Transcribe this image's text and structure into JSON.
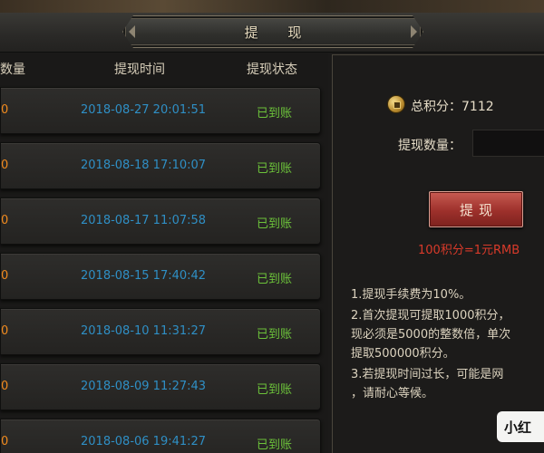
{
  "header": {
    "title": "提 现"
  },
  "table": {
    "columns": {
      "qty": "数量",
      "time": "提现时间",
      "status": "提现状态"
    },
    "rows": [
      {
        "qty": "0",
        "time": "2018-08-27 20:01:51",
        "status": "已到账"
      },
      {
        "qty": "0",
        "time": "2018-08-18 17:10:07",
        "status": "已到账"
      },
      {
        "qty": "0",
        "time": "2018-08-17 11:07:58",
        "status": "已到账"
      },
      {
        "qty": "0",
        "time": "2018-08-15 17:40:42",
        "status": "已到账"
      },
      {
        "qty": "0",
        "time": "2018-08-10 11:31:27",
        "status": "已到账"
      },
      {
        "qty": "0",
        "time": "2018-08-09 11:27:43",
        "status": "已到账"
      },
      {
        "qty": "0",
        "time": "2018-08-06 19:41:27",
        "status": "已到账"
      }
    ]
  },
  "panel": {
    "points_label": "总积分：7112",
    "qty_label": "提现数量：",
    "qty_value": "",
    "withdraw_button": "提现",
    "rate": "100积分=1元RMB",
    "rules": [
      "1.提现手续费为10%。",
      "2.首次提现可提取1000积分，",
      "现必须是5000的整数倍，单次",
      "提取500000积分。",
      "3.若提现时间过长，可能是网",
      "，请耐心等候。"
    ]
  },
  "watermark": {
    "text": "小红"
  },
  "colors": {
    "qty": "#f08a1e",
    "time": "#2f8fc5",
    "status": "#6cc23a",
    "rate": "#d93a2a",
    "button": "#9d302b"
  },
  "icons": {
    "coin": "coin-icon",
    "left_ornament": "arrow-left-icon",
    "right_ornament": "arrow-right-icon"
  }
}
